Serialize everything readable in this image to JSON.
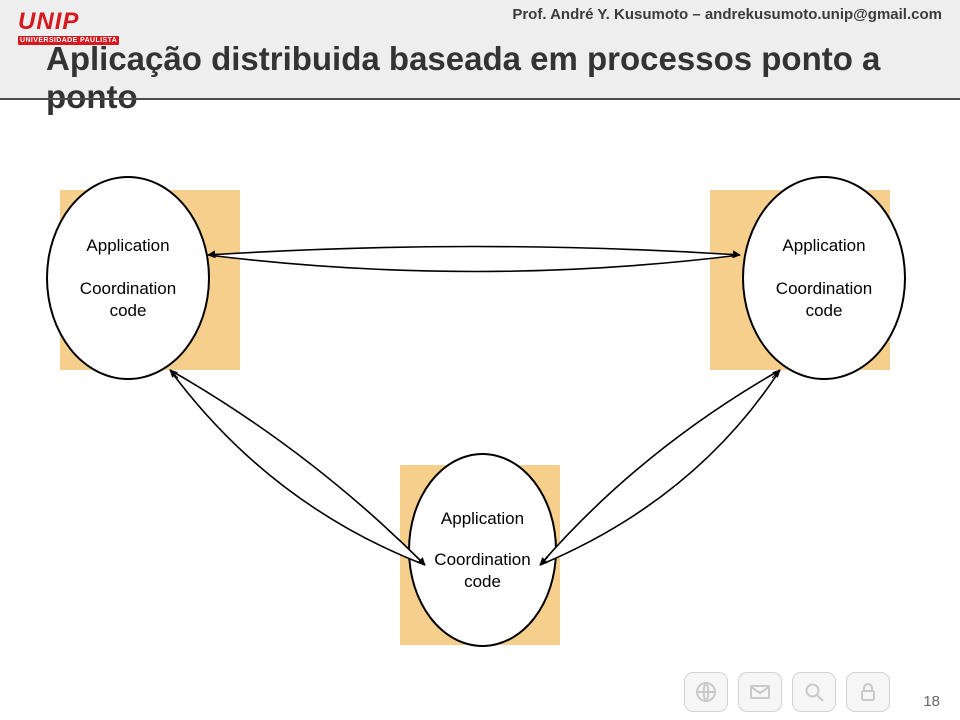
{
  "header": {
    "logo": {
      "text": "UNIP",
      "subtitle": "UNIVERSIDADE PAULISTA"
    },
    "credit": "Prof. André Y. Kusumoto – andrekusumoto.unip@gmail.com",
    "title": "Aplicação distribuida baseada em processos ponto a ponto"
  },
  "diagram": {
    "nodes": {
      "topLeft": {
        "application": "Application",
        "coordination": "Coordination",
        "code": "code"
      },
      "topRight": {
        "application": "Application",
        "coordination": "Coordination",
        "code": "code"
      },
      "bottom": {
        "application": "Application",
        "coordination": "Coordination",
        "code": "code"
      }
    }
  },
  "footer": {
    "icons": [
      "globe-icon",
      "mail-icon",
      "search-icon",
      "lock-icon"
    ],
    "pageNumber": "18"
  }
}
